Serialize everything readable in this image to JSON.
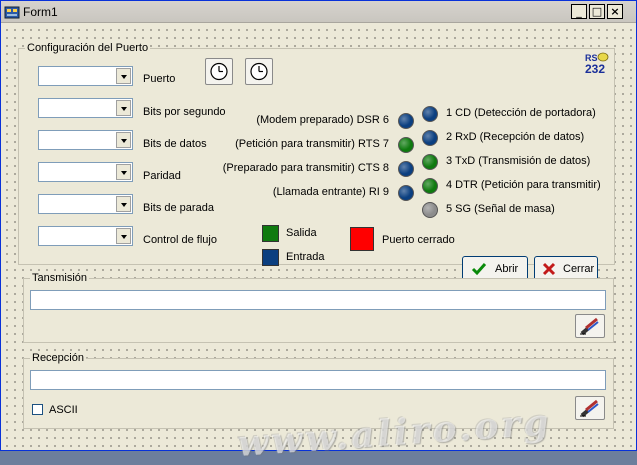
{
  "window": {
    "title": "Form1"
  },
  "config": {
    "legend": "Configuración del Puerto",
    "fields": [
      {
        "label": "Puerto",
        "value": ""
      },
      {
        "label": "Bits por segundo",
        "value": ""
      },
      {
        "label": "Bits de datos",
        "value": ""
      },
      {
        "label": "Paridad",
        "value": ""
      },
      {
        "label": "Bits de parada",
        "value": ""
      },
      {
        "label": "Control de flujo",
        "value": ""
      }
    ],
    "left_signals": [
      {
        "label": "(Modem preparado) DSR 6",
        "color": "#0b3f80"
      },
      {
        "label": "(Petición para transmitir) RTS  7",
        "color": "#0f7a0f"
      },
      {
        "label": "(Preparado para transmitir) CTS  8",
        "color": "#0b3f80"
      },
      {
        "label": "(Llamada entrante) RI 9",
        "color": "#0b3f80"
      }
    ],
    "right_signals": [
      {
        "label": "1 CD   (Detección de portadora)",
        "color": "#0b3f80"
      },
      {
        "label": "2 RxD (Recepción de datos)",
        "color": "#0b3f80"
      },
      {
        "label": "3 TxD (Transmisión de datos)",
        "color": "#0f7a0f"
      },
      {
        "label": "4 DTR (Petición para transmitir)",
        "color": "#0f7a0f"
      },
      {
        "label": "5 SG (Señal de masa)",
        "color": "#8c8c8c"
      }
    ],
    "legend_salida": {
      "label": "Salida",
      "color": "#0f7a0f"
    },
    "legend_entrada": {
      "label": "Entrada",
      "color": "#0b3f80"
    },
    "port_status": {
      "label": "Puerto cerrado",
      "color": "#ff0000"
    },
    "rs232_logo": {
      "top": "RS",
      "bottom": "232"
    },
    "open_button": "Abrir",
    "close_button": "Cerrar"
  },
  "transmission": {
    "legend": "Tansmisión",
    "value": ""
  },
  "reception": {
    "legend": "Recepción",
    "value": "",
    "ascii_label": "ASCII",
    "ascii_checked": false
  },
  "watermark": "www.aliro.org"
}
